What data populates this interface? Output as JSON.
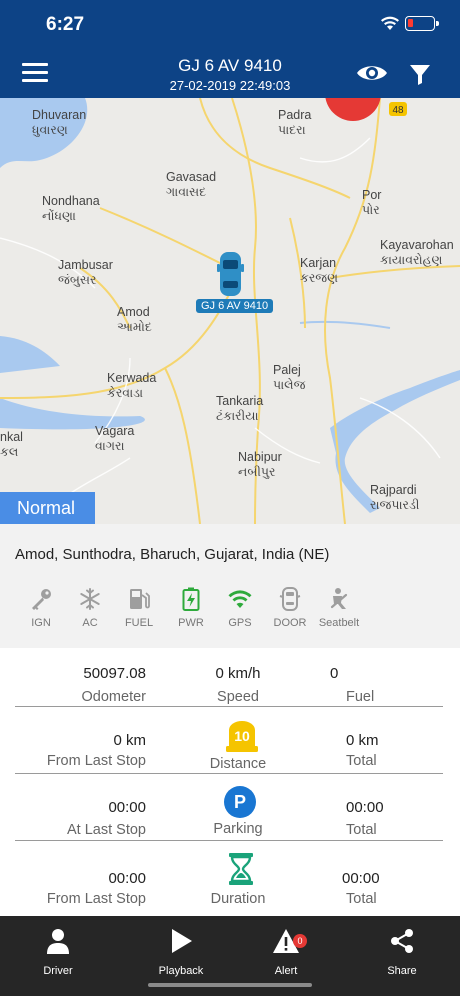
{
  "status_bar": {
    "time": "6:27"
  },
  "header": {
    "vehicle_number": "GJ 6 AV 9410",
    "datetime": "27-02-2019 22:49:03",
    "menu_icon": "hamburger-icon",
    "eye_icon": "eye-icon",
    "filter_icon": "filter-icon"
  },
  "map": {
    "places": [
      {
        "name": "Dhuvaran",
        "local": "ધુવારણ"
      },
      {
        "name": "Padra",
        "local": "પાદરા"
      },
      {
        "name": "Gavasad",
        "local": "ગાવાસદ"
      },
      {
        "name": "Nondhana",
        "local": "નોંધણા"
      },
      {
        "name": "Por",
        "local": "પોર"
      },
      {
        "name": "Kayavarohan",
        "local": "કાયાવરોહણ"
      },
      {
        "name": "Jambusar",
        "local": "જંબુસર"
      },
      {
        "name": "Karjan",
        "local": "કરજણ"
      },
      {
        "name": "Amod",
        "local": "આમોદ"
      },
      {
        "name": "Palej",
        "local": "પાલેજ"
      },
      {
        "name": "Kerwada",
        "local": "કેરવાડા"
      },
      {
        "name": "Tankaria",
        "local": "ટંકારીયા"
      },
      {
        "name": "nkal",
        "local": "કલ"
      },
      {
        "name": "Vagara",
        "local": "વાગરા"
      },
      {
        "name": "Nabipur",
        "local": "નબીપુર"
      },
      {
        "name": "Rajpardi",
        "local": "રાજપારડી"
      }
    ],
    "road_shield": "48",
    "vehicle_label": "GJ 6 AV 9410",
    "status_badge": "Normal"
  },
  "address": "Amod, Sunthodra, Bharuch, Gujarat, India (NE)",
  "indicators": [
    {
      "label": "IGN",
      "icon": "key-icon",
      "color": "#9e9e9e"
    },
    {
      "label": "AC",
      "icon": "snowflake-icon",
      "color": "#9e9e9e"
    },
    {
      "label": "FUEL",
      "icon": "fuel-pump-icon",
      "color": "#9e9e9e"
    },
    {
      "label": "PWR",
      "icon": "battery-charging-icon",
      "color": "#2eaa3c"
    },
    {
      "label": "GPS",
      "icon": "wifi-signal-icon",
      "color": "#2eaa3c"
    },
    {
      "label": "DOOR",
      "icon": "car-door-icon",
      "color": "#9e9e9e"
    },
    {
      "label": "Seatbelt",
      "icon": "seatbelt-icon",
      "color": "#9e9e9e"
    }
  ],
  "stats": {
    "row1": {
      "left_value": "50097.08",
      "left_label": "Odometer",
      "center_value": "0 km/h",
      "center_label": "Speed",
      "right_value": "0",
      "right_label": "Fuel"
    },
    "row2": {
      "left_value": "0 km",
      "left_label": "From Last Stop",
      "center_badge": "10",
      "center_label": "Distance",
      "right_value": "0 km",
      "right_label": "Total"
    },
    "row3": {
      "left_value": "00:00",
      "left_label": "At Last Stop",
      "center_badge": "P",
      "center_label": "Parking",
      "right_value": "00:00",
      "right_label": "Total"
    },
    "row4": {
      "left_value": "00:00",
      "left_label": "From Last Stop",
      "center_label": "Duration",
      "right_value": "00:00",
      "right_label": "Total"
    }
  },
  "bottom_nav": [
    {
      "label": "Driver",
      "icon": "person-icon"
    },
    {
      "label": "Playback",
      "icon": "play-icon"
    },
    {
      "label": "Alert",
      "icon": "alert-icon",
      "badge": "0"
    },
    {
      "label": "Share",
      "icon": "share-icon"
    }
  ],
  "colors": {
    "header": "#0d4386",
    "badge": "#4a8de5",
    "active": "#2eaa3c",
    "bottom_bar": "#262626"
  }
}
